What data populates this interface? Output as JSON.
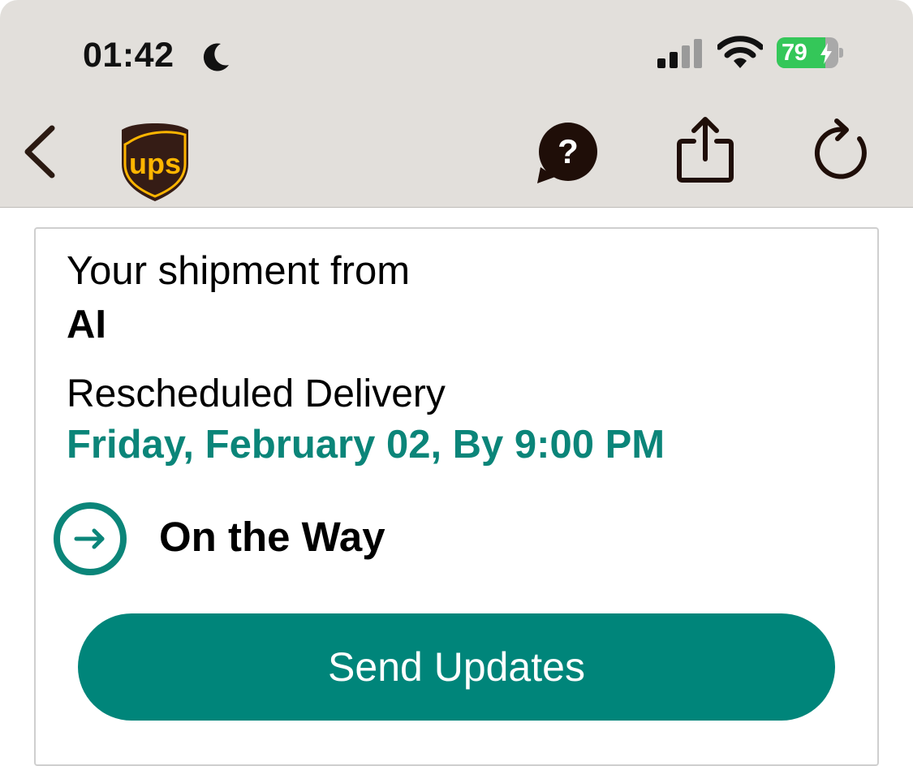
{
  "status_bar": {
    "time": "01:42",
    "battery_percent": "79",
    "battery_level": 0.79,
    "icons": [
      "moon-icon",
      "signal-icon",
      "wifi-icon",
      "battery-icon"
    ]
  },
  "nav": {
    "brand": "UPS",
    "logo_text": "ups",
    "icons": [
      "back-icon",
      "help-chat-icon",
      "share-icon",
      "refresh-icon"
    ]
  },
  "shipment": {
    "from_label": "Your shipment from",
    "sender": "AI",
    "delivery_label": "Rescheduled Delivery",
    "delivery_date": "Friday, February 02, By 9:00 PM",
    "status": "On the Way",
    "status_icon": "arrow-right-circle-icon"
  },
  "actions": {
    "send_updates_label": "Send Updates"
  },
  "colors": {
    "accent": "#00857a",
    "date_text": "#0b8579",
    "ups_brown": "#351c15",
    "ups_gold": "#ffb500",
    "topbar_bg": "#e2dfdb",
    "battery_green": "#34c759"
  }
}
